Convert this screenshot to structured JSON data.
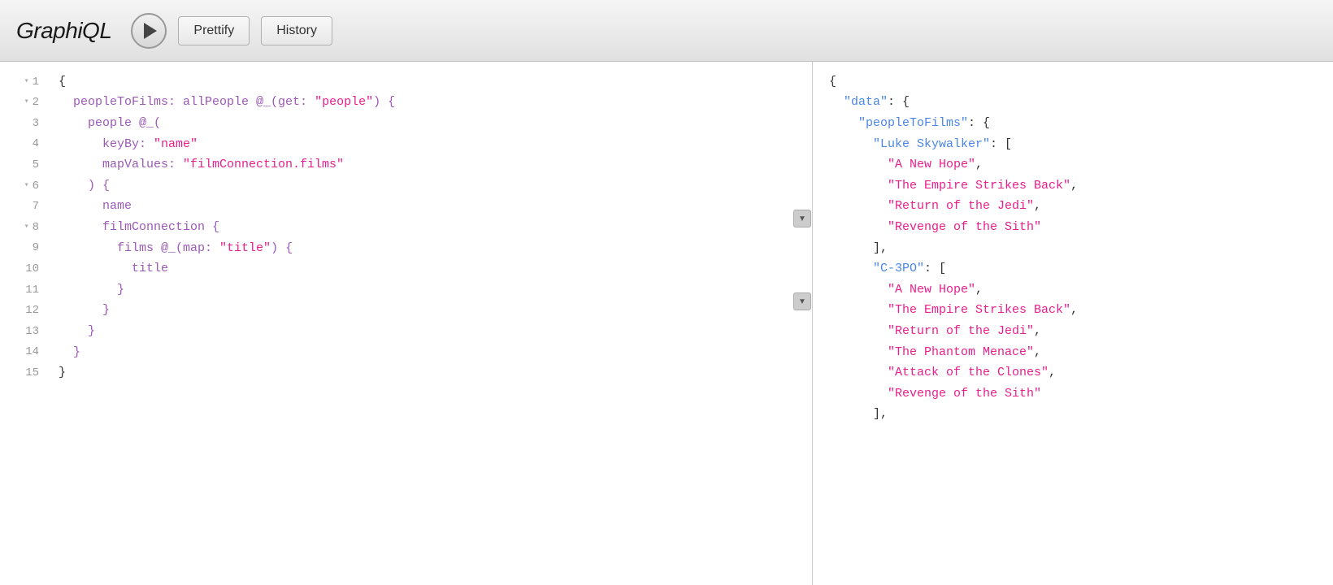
{
  "app": {
    "title_regular": "Graph",
    "title_italic": "iQL"
  },
  "toolbar": {
    "prettify_label": "Prettify",
    "history_label": "History"
  },
  "editor": {
    "lines": [
      {
        "num": 1,
        "fold": true,
        "content": [
          {
            "t": "{",
            "c": "c-black"
          }
        ]
      },
      {
        "num": 2,
        "fold": true,
        "content": [
          {
            "t": "  peopleToFilms: allPeople @_(get: ",
            "c": "c-purple"
          },
          {
            "t": "\"people\"",
            "c": "c-pink"
          },
          {
            "t": ") {",
            "c": "c-purple"
          }
        ]
      },
      {
        "num": 3,
        "fold": false,
        "content": [
          {
            "t": "    people @_(",
            "c": "c-purple"
          }
        ]
      },
      {
        "num": 4,
        "fold": false,
        "content": [
          {
            "t": "      keyBy: ",
            "c": "c-purple"
          },
          {
            "t": "\"name\"",
            "c": "c-pink"
          }
        ]
      },
      {
        "num": 5,
        "fold": false,
        "content": [
          {
            "t": "      mapValues: ",
            "c": "c-purple"
          },
          {
            "t": "\"filmConnection.films\"",
            "c": "c-pink"
          }
        ]
      },
      {
        "num": 6,
        "fold": true,
        "content": [
          {
            "t": "    ) {",
            "c": "c-purple"
          }
        ]
      },
      {
        "num": 7,
        "fold": false,
        "content": [
          {
            "t": "      name",
            "c": "c-purple"
          }
        ]
      },
      {
        "num": 8,
        "fold": true,
        "content": [
          {
            "t": "      filmConnection {",
            "c": "c-purple"
          }
        ]
      },
      {
        "num": 9,
        "fold": false,
        "content": [
          {
            "t": "        films @_(map: ",
            "c": "c-purple"
          },
          {
            "t": "\"title\"",
            "c": "c-pink"
          },
          {
            "t": ") {",
            "c": "c-purple"
          }
        ]
      },
      {
        "num": 10,
        "fold": false,
        "content": [
          {
            "t": "          title",
            "c": "c-purple"
          }
        ]
      },
      {
        "num": 11,
        "fold": false,
        "content": [
          {
            "t": "        }",
            "c": "c-purple"
          }
        ]
      },
      {
        "num": 12,
        "fold": false,
        "content": [
          {
            "t": "      }",
            "c": "c-purple"
          }
        ]
      },
      {
        "num": 13,
        "fold": false,
        "content": [
          {
            "t": "    }",
            "c": "c-purple"
          }
        ]
      },
      {
        "num": 14,
        "fold": false,
        "content": [
          {
            "t": "  }",
            "c": "c-purple"
          }
        ]
      },
      {
        "num": 15,
        "fold": false,
        "content": [
          {
            "t": "}",
            "c": "c-black"
          }
        ]
      }
    ]
  },
  "result": {
    "lines": [
      {
        "indent": 0,
        "parts": [
          {
            "t": "{",
            "c": "r-punct"
          }
        ]
      },
      {
        "indent": 1,
        "parts": [
          {
            "t": "\"data\"",
            "c": "r-key"
          },
          {
            "t": ": {",
            "c": "r-punct"
          }
        ]
      },
      {
        "indent": 2,
        "parts": [
          {
            "t": "\"peopleToFilms\"",
            "c": "r-key"
          },
          {
            "t": ": {",
            "c": "r-punct"
          }
        ]
      },
      {
        "indent": 3,
        "parts": [
          {
            "t": "\"Luke Skywalker\"",
            "c": "r-key"
          },
          {
            "t": ": [",
            "c": "r-punct"
          }
        ]
      },
      {
        "indent": 4,
        "parts": [
          {
            "t": "\"A New Hope\"",
            "c": "r-string"
          },
          {
            "t": ",",
            "c": "r-punct"
          }
        ]
      },
      {
        "indent": 4,
        "parts": [
          {
            "t": "\"The Empire Strikes Back\"",
            "c": "r-string"
          },
          {
            "t": ",",
            "c": "r-punct"
          }
        ]
      },
      {
        "indent": 4,
        "parts": [
          {
            "t": "\"Return of the Jedi\"",
            "c": "r-string"
          },
          {
            "t": ",",
            "c": "r-punct"
          }
        ]
      },
      {
        "indent": 4,
        "parts": [
          {
            "t": "\"Revenge of the Sith\"",
            "c": "r-string"
          }
        ]
      },
      {
        "indent": 3,
        "parts": [
          {
            "t": "],",
            "c": "r-punct"
          }
        ]
      },
      {
        "indent": 3,
        "parts": [
          {
            "t": "\"C-3PO\"",
            "c": "r-key"
          },
          {
            "t": ": [",
            "c": "r-punct"
          }
        ]
      },
      {
        "indent": 4,
        "parts": [
          {
            "t": "\"A New Hope\"",
            "c": "r-string"
          },
          {
            "t": ",",
            "c": "r-punct"
          }
        ]
      },
      {
        "indent": 4,
        "parts": [
          {
            "t": "\"The Empire Strikes Back\"",
            "c": "r-string"
          },
          {
            "t": ",",
            "c": "r-punct"
          }
        ]
      },
      {
        "indent": 4,
        "parts": [
          {
            "t": "\"Return of the Jedi\"",
            "c": "r-string"
          },
          {
            "t": ",",
            "c": "r-punct"
          }
        ]
      },
      {
        "indent": 4,
        "parts": [
          {
            "t": "\"The Phantom Menace\"",
            "c": "r-string"
          },
          {
            "t": ",",
            "c": "r-punct"
          }
        ]
      },
      {
        "indent": 4,
        "parts": [
          {
            "t": "\"Attack of the Clones\"",
            "c": "r-string"
          },
          {
            "t": ",",
            "c": "r-punct"
          }
        ]
      },
      {
        "indent": 4,
        "parts": [
          {
            "t": "\"Revenge of the Sith\"",
            "c": "r-string"
          }
        ]
      },
      {
        "indent": 3,
        "parts": [
          {
            "t": "],",
            "c": "r-punct"
          }
        ]
      }
    ]
  }
}
